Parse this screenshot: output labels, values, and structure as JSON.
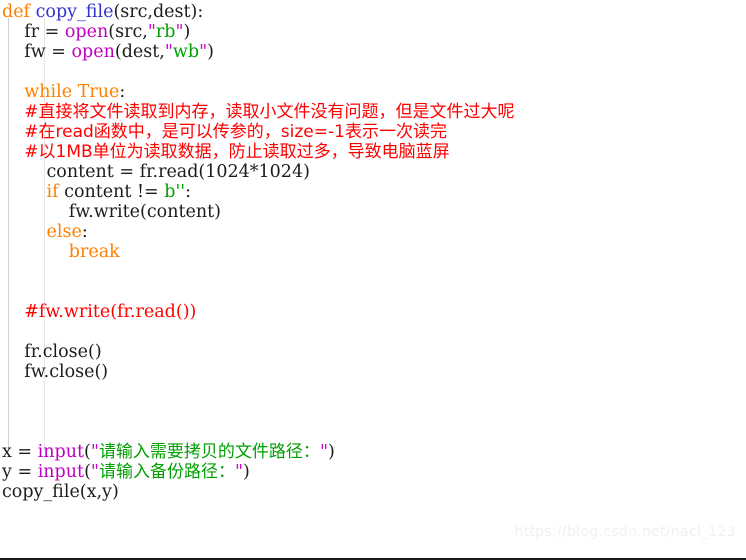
{
  "editor": {
    "language": "python",
    "background_color": "#ffffff",
    "bottom_border_color": "#1b1b1b",
    "indent_guide_color": "#d3d3d3"
  },
  "theme": {
    "keyword_color": "#ff8000",
    "function_color": "#3333cc",
    "builtin_color": "#c000c0",
    "string_color": "#00a000",
    "quote_color": "#cc00cc",
    "comment_color": "#ff0000",
    "plain_color": "#1c1c1c"
  },
  "code": {
    "line_01": {
      "kw_def": "def",
      "space_1": " ",
      "func_name": "copy_file",
      "params": "(src,dest):"
    },
    "line_02": {
      "indent": "    fr = ",
      "builtin": "open",
      "open_paren": "(src,",
      "quote_open": "\"",
      "string": "rb",
      "quote_close": "\"",
      "close_paren": ")"
    },
    "line_03": {
      "indent": "    fw = ",
      "builtin": "open",
      "open_paren": "(dest,",
      "quote_open": "\"",
      "string": "wb",
      "quote_close": "\"",
      "close_paren": ")"
    },
    "line_04": {
      "blank": ""
    },
    "line_05": {
      "indent": "    ",
      "kw_while": "while",
      "space": " ",
      "kw_true": "True",
      "colon": ":"
    },
    "line_06": {
      "indent": "    ",
      "comment": "#直接将文件读取到内存，读取小文件没有问题，但是文件过大呢"
    },
    "line_07": {
      "indent": "    ",
      "comment": "#在read函数中，是可以传参的，size=-1表示一次读完"
    },
    "line_08": {
      "indent": "    ",
      "comment": "#以1MB单位为读取数据，防止读取过多，导致电脑蓝屏"
    },
    "line_09": {
      "text": "        content = fr.read(1024*1024)"
    },
    "line_10": {
      "indent": "        ",
      "kw_if": "if",
      "expr": " content != ",
      "bytes_literal": "b''",
      "colon": ":"
    },
    "line_11": {
      "text": "            fw.write(content)"
    },
    "line_12": {
      "indent": "        ",
      "kw_else": "else",
      "colon": ":"
    },
    "line_13": {
      "indent": "            ",
      "kw_break": "break"
    },
    "line_14": {
      "blank": ""
    },
    "line_15": {
      "blank": ""
    },
    "line_16": {
      "indent": "    ",
      "comment": "#fw.write(fr.read())"
    },
    "line_17": {
      "blank": ""
    },
    "line_18": {
      "text": "    fr.close()"
    },
    "line_19": {
      "text": "    fw.close()"
    },
    "line_20": {
      "blank": ""
    },
    "line_21": {
      "blank": ""
    },
    "line_22": {
      "blank": ""
    },
    "line_23": {
      "assign": "x = ",
      "builtin": "input",
      "open_paren": "(",
      "quote_open": "\"",
      "string": "请输入需要拷贝的文件路径：",
      "quote_close": "\"",
      "close_paren": ")"
    },
    "line_24": {
      "assign": "y = ",
      "builtin": "input",
      "open_paren": "(",
      "quote_open": "\"",
      "string": "请输入备份路径：",
      "quote_close": "\"",
      "close_paren": ")"
    },
    "line_25": {
      "text": "copy_file(x,y)"
    }
  },
  "watermark": {
    "text": "https://blog.csdn.net/nacl_123"
  }
}
